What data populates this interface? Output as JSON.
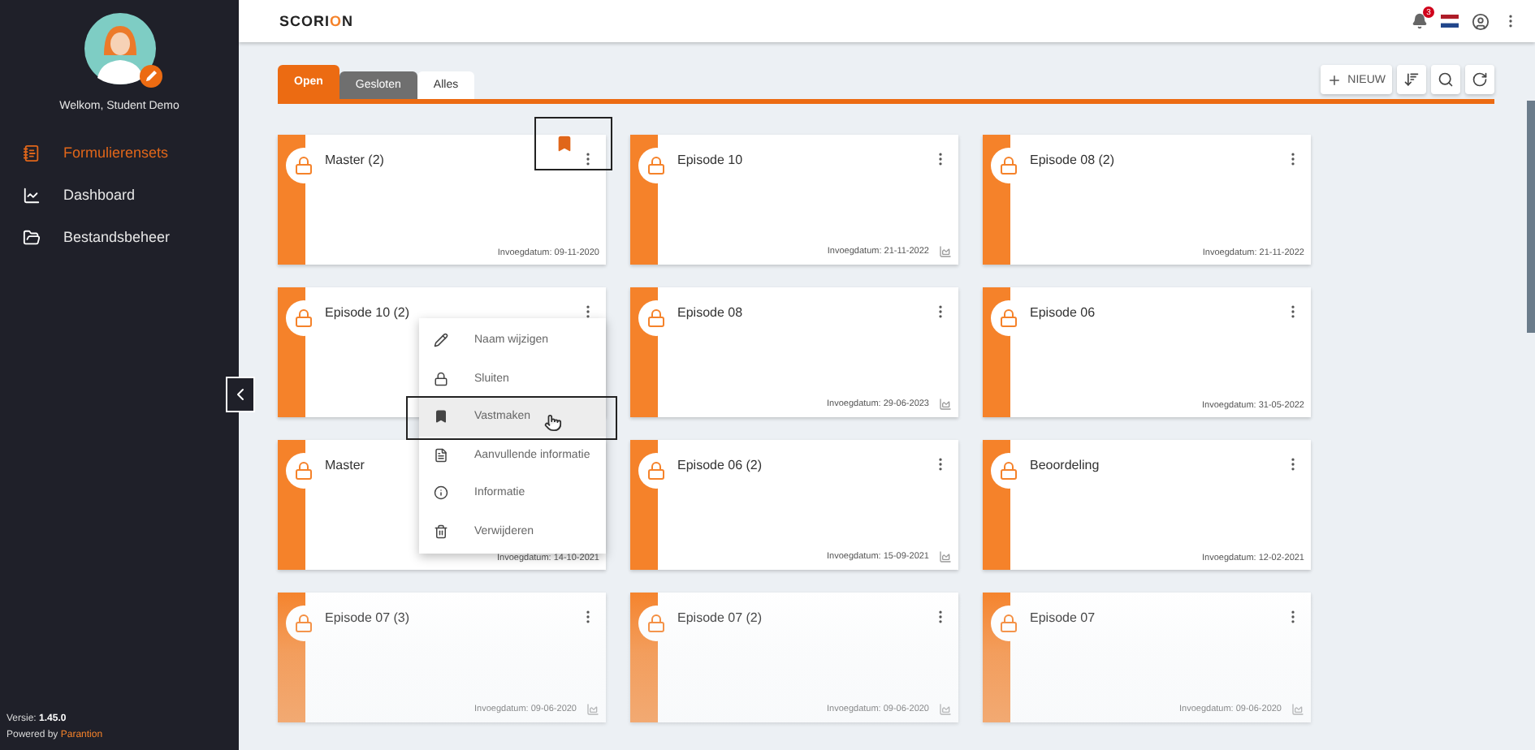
{
  "sidebar": {
    "welcome": "Welkom, Student Demo",
    "items": [
      {
        "label": "Formulierensets",
        "kind": "forms",
        "selected": true
      },
      {
        "label": "Dashboard",
        "kind": "dashboard",
        "selected": false
      },
      {
        "label": "Bestandsbeheer",
        "kind": "files",
        "selected": false
      }
    ],
    "version_label": "Versie:",
    "version": "1.45.0",
    "powered_by": "Powered by",
    "brand": "Parantion"
  },
  "header": {
    "logo": [
      {
        "text": "SCORI",
        "accent": false
      },
      {
        "text": "O",
        "accent": true
      },
      {
        "text": "N",
        "accent": false
      }
    ],
    "notifications": "3"
  },
  "tabs": [
    {
      "label": "Open",
      "selected": true,
      "color": "#ec6b12"
    },
    {
      "label": "Gesloten",
      "selected": false,
      "color": "#6f6f6f"
    },
    {
      "label": "Alles",
      "selected": false,
      "color": "#ffffff"
    }
  ],
  "toolbar": {
    "new_button": "NIEUW"
  },
  "cards": [
    {
      "title": "Master (2)",
      "date": "Invoegdatum: 09-11-2020",
      "pinned": true,
      "chart": false
    },
    {
      "title": "Episode 10",
      "date": "Invoegdatum: 21-11-2022",
      "pinned": false,
      "chart": true
    },
    {
      "title": "Episode 08 (2)",
      "date": "Invoegdatum: 21-11-2022",
      "pinned": false,
      "chart": false
    },
    {
      "title": "Episode 10 (2)",
      "pinned": false,
      "chart": false
    },
    {
      "title": "Episode 08",
      "date": "Invoegdatum: 29-06-2023",
      "pinned": false,
      "chart": true
    },
    {
      "title": "Episode 06",
      "date": "Invoegdatum: 31-05-2022",
      "pinned": false,
      "chart": false
    },
    {
      "title": "Master",
      "date": "Invoegdatum: 14-10-2021",
      "pinned": false,
      "chart": false,
      "menu_covered": true
    },
    {
      "title": "Episode 06 (2)",
      "date": "Invoegdatum: 15-09-2021",
      "pinned": false,
      "chart": true
    },
    {
      "title": "Beoordeling",
      "date": "Invoegdatum: 12-02-2021",
      "pinned": false,
      "chart": false
    },
    {
      "title": "Episode 07 (3)",
      "date": "Invoegdatum: 09-06-2020",
      "pinned": false,
      "chart": true
    },
    {
      "title": "Episode 07 (2)",
      "date": "Invoegdatum: 09-06-2020",
      "pinned": false,
      "chart": true
    },
    {
      "title": "Episode 07",
      "date": "Invoegdatum: 09-06-2020",
      "pinned": false,
      "chart": true
    }
  ],
  "context_menu": {
    "items": [
      {
        "label": "Naam wijzigen",
        "kind": "rename",
        "selected": false
      },
      {
        "label": "Sluiten",
        "kind": "close",
        "selected": false
      },
      {
        "label": "Vastmaken",
        "kind": "pin",
        "selected": true
      },
      {
        "label": "Aanvullende informatie",
        "kind": "details",
        "selected": false
      },
      {
        "label": "Informatie",
        "kind": "info",
        "selected": false
      },
      {
        "label": "Verwijderen",
        "kind": "delete",
        "selected": false
      }
    ]
  }
}
